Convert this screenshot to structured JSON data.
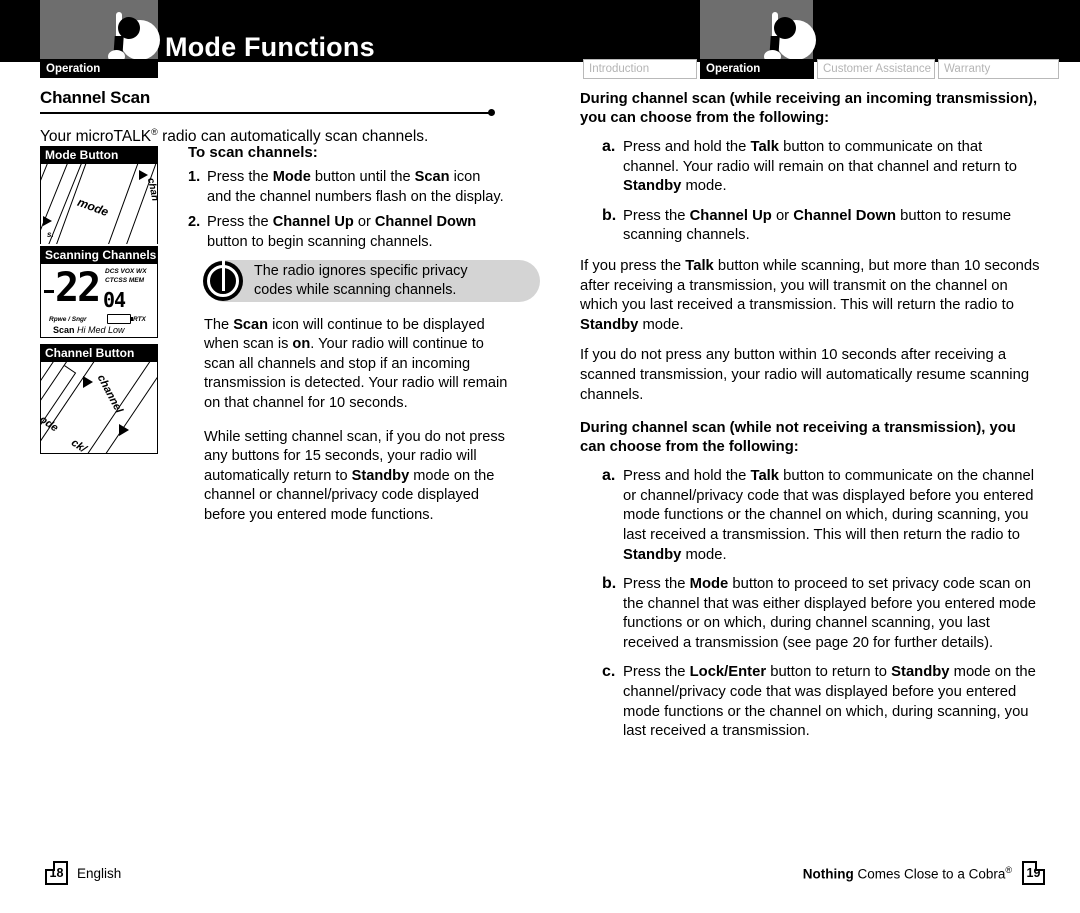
{
  "header": {
    "title": "Mode Functions",
    "left_tab_label": "Operation",
    "logo_name": "cobra-radio-logo",
    "tabs": [
      {
        "label": "Introduction",
        "active": false
      },
      {
        "label": "Operation",
        "active": true
      },
      {
        "label": "Customer Assistance",
        "active": false
      },
      {
        "label": "Warranty",
        "active": false
      }
    ]
  },
  "left": {
    "section_title": "Channel Scan",
    "intro": "Your microTALK",
    "intro_sup": "®",
    "intro_rest": " radio can automatically scan channels.",
    "figures": {
      "mode_button": {
        "caption": "Mode Button",
        "label": "mode",
        "side_label": "chan"
      },
      "scanning_channels": {
        "caption": "Scanning Channels",
        "channel": "22",
        "code": "04",
        "indicators_row1": "DCS VOX WX",
        "indicators_row2": "CTCSS MEM",
        "meter_row": "Rpwe / Sngr",
        "rtx": "RTX",
        "scan_label": "Scan",
        "power_levels": "Hi  Med  Low"
      },
      "channel_button": {
        "caption": "Channel Button",
        "label": "channel",
        "side_label_a": "ode",
        "side_label_b": "ck/"
      }
    },
    "steps_heading": "To scan channels:",
    "steps": [
      {
        "num": "1.",
        "parts": [
          {
            "t": "Press the ",
            "b": false
          },
          {
            "t": "Mode",
            "b": true
          },
          {
            "t": " button until the ",
            "b": false
          },
          {
            "t": "Scan",
            "b": true
          },
          {
            "t": " icon and the channel numbers flash on the display.",
            "b": false
          }
        ]
      },
      {
        "num": "2.",
        "parts": [
          {
            "t": "Press the ",
            "b": false
          },
          {
            "t": "Channel Up",
            "b": true
          },
          {
            "t": " or ",
            "b": false
          },
          {
            "t": "Channel Down",
            "b": true
          },
          {
            "t": " button to begin scanning channels.",
            "b": false
          }
        ]
      }
    ],
    "callout": {
      "icon": "power-button-icon",
      "line1": "The radio ignores specific privacy",
      "line2": "codes while scanning channels."
    },
    "paragraphs": [
      [
        {
          "t": "The ",
          "b": false
        },
        {
          "t": "Scan",
          "b": true
        },
        {
          "t": " icon will continue to be displayed when scan is ",
          "b": false
        },
        {
          "t": "on",
          "b": true
        },
        {
          "t": ". Your radio will continue to scan all channels and stop if an incoming transmission is detected. Your radio will remain on that channel for 10 seconds.",
          "b": false
        }
      ],
      [
        {
          "t": "While setting channel scan, if you do not press any buttons for 15 seconds, your radio will automatically return to ",
          "b": false
        },
        {
          "t": "Standby",
          "b": true
        },
        {
          "t": " mode on the channel or channel/privacy code displayed before you entered mode functions.",
          "b": false
        }
      ]
    ]
  },
  "right": {
    "blocks": [
      {
        "type": "heading",
        "parts": [
          {
            "t": "During channel scan (while receiving an incoming transmission), you can choose from the following:",
            "b": true
          }
        ]
      },
      {
        "type": "item",
        "letter": "a.",
        "parts": [
          {
            "t": "Press and hold the ",
            "b": false
          },
          {
            "t": "Talk",
            "b": true
          },
          {
            "t": " button to communicate on that channel. Your radio will remain on that channel and return to ",
            "b": false
          },
          {
            "t": "Standby",
            "b": true
          },
          {
            "t": " mode.",
            "b": false
          }
        ]
      },
      {
        "type": "item",
        "letter": "b.",
        "parts": [
          {
            "t": "Press the ",
            "b": false
          },
          {
            "t": "Channel Up",
            "b": true
          },
          {
            "t": " or ",
            "b": false
          },
          {
            "t": "Channel Down",
            "b": true
          },
          {
            "t": " button to resume scanning channels.",
            "b": false
          }
        ]
      },
      {
        "type": "para",
        "parts": [
          {
            "t": "If you press the ",
            "b": false
          },
          {
            "t": "Talk",
            "b": true
          },
          {
            "t": " button while scanning, but more than 10 seconds after receiving a transmission, you will transmit on the channel on which you last received a transmission. This will return the radio to ",
            "b": false
          },
          {
            "t": "Standby",
            "b": true
          },
          {
            "t": " mode.",
            "b": false
          }
        ]
      },
      {
        "type": "para",
        "parts": [
          {
            "t": "If you do not press any button within 10 seconds after receiving a scanned transmission, your radio will automatically resume scanning channels.",
            "b": false
          }
        ]
      },
      {
        "type": "heading",
        "parts": [
          {
            "t": "During channel scan (while not receiving a transmission), you can choose from the following:",
            "b": true
          }
        ]
      },
      {
        "type": "item",
        "letter": "a.",
        "parts": [
          {
            "t": "Press and hold the ",
            "b": false
          },
          {
            "t": "Talk",
            "b": true
          },
          {
            "t": " button to communicate on the channel or channel/privacy code that was displayed before you entered mode functions or the channel on which, during scanning, you last received a transmission. This will then return the radio to ",
            "b": false
          },
          {
            "t": "Standby",
            "b": true
          },
          {
            "t": " mode.",
            "b": false
          }
        ]
      },
      {
        "type": "item",
        "letter": "b.",
        "parts": [
          {
            "t": "Press the ",
            "b": false
          },
          {
            "t": "Mode",
            "b": true
          },
          {
            "t": " button to proceed to set privacy code scan on the channel that was either displayed before you entered mode functions or on which, during channel scanning, you last received a transmission (see page 20 for further details).",
            "b": false
          }
        ]
      },
      {
        "type": "item",
        "letter": "c.",
        "parts": [
          {
            "t": "Press the ",
            "b": false
          },
          {
            "t": "Lock/Enter",
            "b": true
          },
          {
            "t": " button to return to ",
            "b": false
          },
          {
            "t": "Standby",
            "b": true
          },
          {
            "t": " mode on the channel/privacy code that was displayed before you entered mode functions or the channel on which, during scanning, you last received a transmission.",
            "b": false
          }
        ]
      }
    ]
  },
  "footer": {
    "left_page": "18",
    "left_label": "English",
    "right_tagline_bold": "Nothing",
    "right_tagline_rest": " Comes Close to a Cobra",
    "right_tagline_sup": "®",
    "right_page": "19"
  },
  "colors": {
    "black": "#000000",
    "header_gray": "#6e6e6e",
    "callout_gray": "#d4d4d4",
    "tab_inactive_text": "#b4b4b4"
  }
}
